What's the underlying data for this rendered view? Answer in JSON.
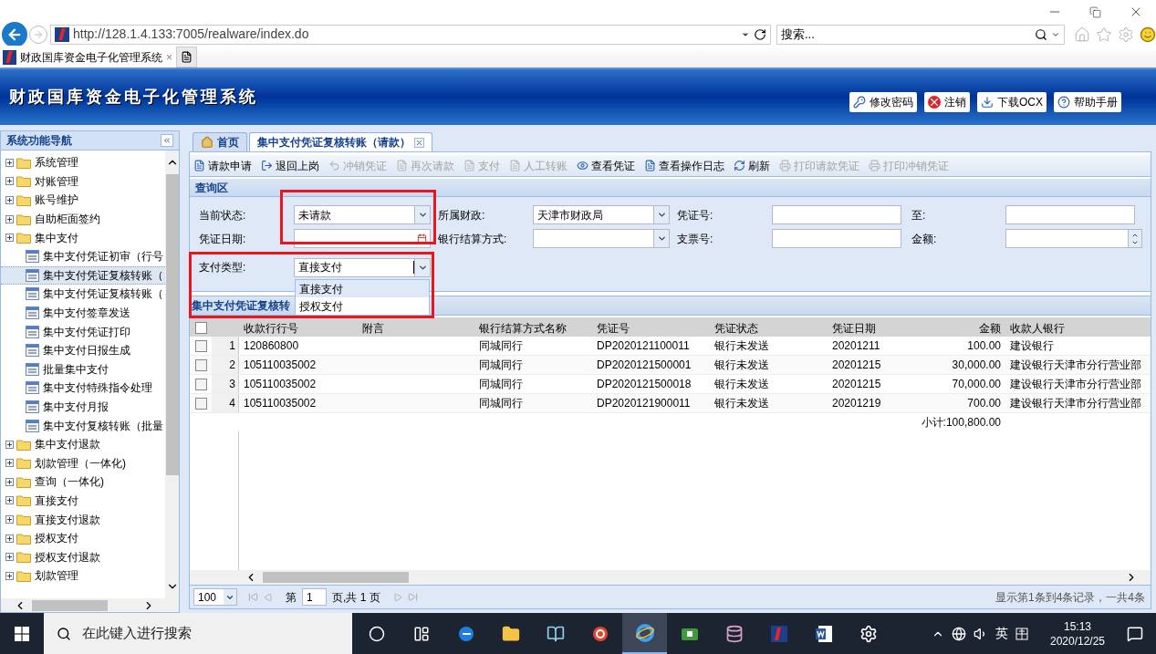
{
  "browser": {
    "url": "http://128.1.4.133:7005/realware/index.do",
    "search_placeholder": "搜索...",
    "tab": {
      "title": "财政国库资金电子化管理系统",
      "close": "×"
    }
  },
  "app": {
    "title": "财政国库资金电子化管理系统",
    "buttons": [
      {
        "label": "修改密码",
        "kind": "password"
      },
      {
        "label": "注销",
        "kind": "logout"
      },
      {
        "label": "下载OCX",
        "kind": "download"
      },
      {
        "label": "帮助手册",
        "kind": "help"
      }
    ]
  },
  "nav": {
    "title": "系统功能导航",
    "items": [
      {
        "label": "系统管理",
        "selected": false
      },
      {
        "label": "对账管理",
        "selected": false
      },
      {
        "label": "账号维护",
        "selected": false
      },
      {
        "label": "自助柜面签约",
        "selected": false
      },
      {
        "label": "集中支付",
        "selected": false,
        "children": [
          {
            "label": "集中支付凭证初审（行号",
            "selected": false
          },
          {
            "label": "集中支付凭证复核转账（",
            "selected": true
          },
          {
            "label": "集中支付凭证复核转账（",
            "selected": false
          },
          {
            "label": "集中支付签章发送",
            "selected": false
          },
          {
            "label": "集中支付凭证打印",
            "selected": false
          },
          {
            "label": "集中支付日报生成",
            "selected": false
          },
          {
            "label": "批量集中支付",
            "selected": false
          },
          {
            "label": "集中支付特殊指令处理",
            "selected": false
          },
          {
            "label": "集中支付月报",
            "selected": false
          },
          {
            "label": "集中支付复核转账（批量",
            "selected": false
          }
        ]
      },
      {
        "label": "集中支付退款",
        "selected": false
      },
      {
        "label": "划款管理（一体化)",
        "selected": false
      },
      {
        "label": "查询（一体化)",
        "selected": false
      },
      {
        "label": "直接支付",
        "selected": false
      },
      {
        "label": "直接支付退款",
        "selected": false
      },
      {
        "label": "授权支付",
        "selected": false
      },
      {
        "label": "授权支付退款",
        "selected": false
      },
      {
        "label": "划款管理",
        "selected": false
      }
    ]
  },
  "tabs": [
    {
      "label": "首页",
      "selected": false,
      "closable": false
    },
    {
      "label": "集中支付凭证复核转账（请款）",
      "selected": true,
      "closable": true
    }
  ],
  "toolbar": [
    {
      "label": "请款申请",
      "kind": "apply",
      "disabled": false
    },
    {
      "label": "退回上岗",
      "kind": "return",
      "disabled": false
    },
    {
      "label": "冲销凭证",
      "kind": "undo",
      "disabled": true
    },
    {
      "label": "再次请款",
      "kind": "apply",
      "disabled": true
    },
    {
      "label": "支付",
      "kind": "apply",
      "disabled": true
    },
    {
      "label": "人工转账",
      "kind": "apply",
      "disabled": true
    },
    {
      "label": "查看凭证",
      "kind": "view",
      "disabled": false
    },
    {
      "label": "查看操作日志",
      "kind": "log",
      "disabled": false
    },
    {
      "label": "刷新",
      "kind": "refresh",
      "disabled": false
    },
    {
      "label": "打印请款凭证",
      "kind": "print",
      "disabled": true
    },
    {
      "label": "打印冲销凭证",
      "kind": "print",
      "disabled": true
    }
  ],
  "query": {
    "title": "查询区",
    "fields": [
      {
        "label": "当前状态:",
        "kind": "select",
        "value": "未请款",
        "expanded": false
      },
      {
        "label": "所属财政:",
        "kind": "select",
        "value": "天津市财政局",
        "expanded": false
      },
      {
        "label": "凭证号:",
        "kind": "text"
      },
      {
        "label": "至:",
        "kind": "text"
      },
      {
        "label": "凭证日期:",
        "kind": "date"
      },
      {
        "label": "银行结算方式:",
        "kind": "select",
        "expanded": false
      },
      {
        "label": "支票号:",
        "kind": "text"
      },
      {
        "label": "金额:",
        "kind": "number"
      },
      {
        "label": "支付类型:",
        "kind": "select",
        "value": "直接支付",
        "expanded": true,
        "options": [
          {
            "label": "直接支付",
            "selected": true
          },
          {
            "label": "授权支付",
            "selected": false
          }
        ]
      }
    ]
  },
  "grid": {
    "title": "集中支付凭证复核转",
    "all_checked": false,
    "columns": [
      {
        "label": "收款行行号"
      },
      {
        "label": "附言"
      },
      {
        "label": "银行结算方式名称"
      },
      {
        "label": "凭证号"
      },
      {
        "label": "凭证状态"
      },
      {
        "label": "凭证日期"
      },
      {
        "label": "金额"
      },
      {
        "label": "收款人银行"
      }
    ],
    "rows": [
      {
        "index": "1",
        "checked": false,
        "cells": [
          "120860800",
          "",
          "同城同行",
          "DP2020121100011",
          "银行未发送",
          "20201211",
          "100.00",
          "建设银行"
        ]
      },
      {
        "index": "2",
        "checked": false,
        "cells": [
          "105110035002",
          "",
          "同城同行",
          "DP2020121500001",
          "银行未发送",
          "20201215",
          "30,000.00",
          "建设银行天津市分行营业部"
        ]
      },
      {
        "index": "3",
        "checked": false,
        "cells": [
          "105110035002",
          "",
          "同城同行",
          "DP2020121500018",
          "银行未发送",
          "20201215",
          "70,000.00",
          "建设银行天津市分行营业部"
        ]
      },
      {
        "index": "4",
        "checked": false,
        "cells": [
          "105110035002",
          "",
          "同城同行",
          "DP2020121900011",
          "银行未发送",
          "20201219",
          "700.00",
          "建设银行天津市分行营业部"
        ]
      }
    ],
    "subtotal": "小计:100,800.00"
  },
  "pager": {
    "page_size": "100",
    "page_prefix": "第",
    "page": "1",
    "page_suffix": "页,共 1 页",
    "summary": "显示第1条到4条记录，一共4条"
  },
  "taskbar": {
    "search_placeholder": "在此键入进行搜索",
    "apps": [
      {
        "kind": "cortana",
        "active": false
      },
      {
        "kind": "taskview",
        "active": false
      },
      {
        "kind": "edge",
        "active": false
      },
      {
        "kind": "folder",
        "active": false
      },
      {
        "kind": "book",
        "active": false
      },
      {
        "kind": "spiral",
        "active": false
      },
      {
        "kind": "ie",
        "active": true
      },
      {
        "kind": "green",
        "active": false
      },
      {
        "kind": "db",
        "active": false
      },
      {
        "kind": "app",
        "active": false
      },
      {
        "kind": "word",
        "active": false
      },
      {
        "kind": "gear",
        "active": false
      }
    ],
    "ime": "英",
    "time": "15:13",
    "date": "2020/12/25"
  }
}
